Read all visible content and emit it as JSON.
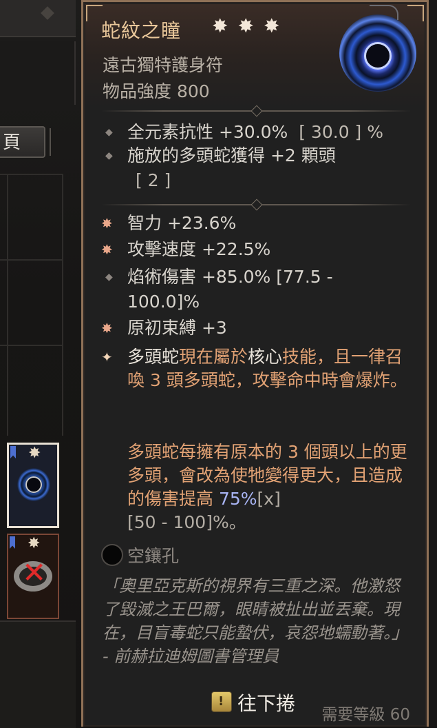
{
  "inventory": {
    "tab_label": "頁",
    "slots": [
      {
        "name": "amulet-slot",
        "selected": true
      },
      {
        "name": "ring-slot",
        "selected": false,
        "unusable": true
      }
    ]
  },
  "tooltip": {
    "title": "蛇紋之瞳",
    "subtitle": "遠古獨特護身符",
    "item_power": "物品強度 800",
    "implicit": [
      {
        "text": "全元素抗性 +30.0%",
        "range": "[ 30.0 ] %"
      },
      {
        "text": "施放的多頭蛇獲得 +2 顆頭",
        "range": "[ 2 ]"
      }
    ],
    "affixes": [
      {
        "text": "智力 +23.6%"
      },
      {
        "text": "攻擊速度 +22.5%"
      },
      {
        "text": "焰術傷害 +85.0% [77.5 -",
        "text2": "100.0]%"
      },
      {
        "text": "原初束縛 +3"
      }
    ],
    "unique_effect": {
      "p1_a": "多頭蛇",
      "p1_b": "現在屬於",
      "p1_c": "核心",
      "p1_d": "技能，且一律召喚 3 頭多頭蛇，攻擊命中時會爆炸。",
      "p2_a": "多頭蛇每擁有原本的 3 個頭以上的更多頭，會改為使牠變得更大，且造成的傷害提高 ",
      "p2_val": "75%",
      "p2_rng1": "[x]",
      "p2_rng2": "[50 - 100]%",
      "p2_end": "。"
    },
    "socket_label": "空鑲孔",
    "flavor": "「奧里亞克斯的視界有三重之深。他激怒了毀滅之王巴爾，眼睛被扯出並丟棄。現在，目盲毒蛇只能蟄伏，哀怨地蠕動著。」 - 前赫拉迪姆圖書管理員",
    "scroll_key": "!",
    "scroll_label": "往下捲",
    "required_level": "需要等級 60"
  }
}
